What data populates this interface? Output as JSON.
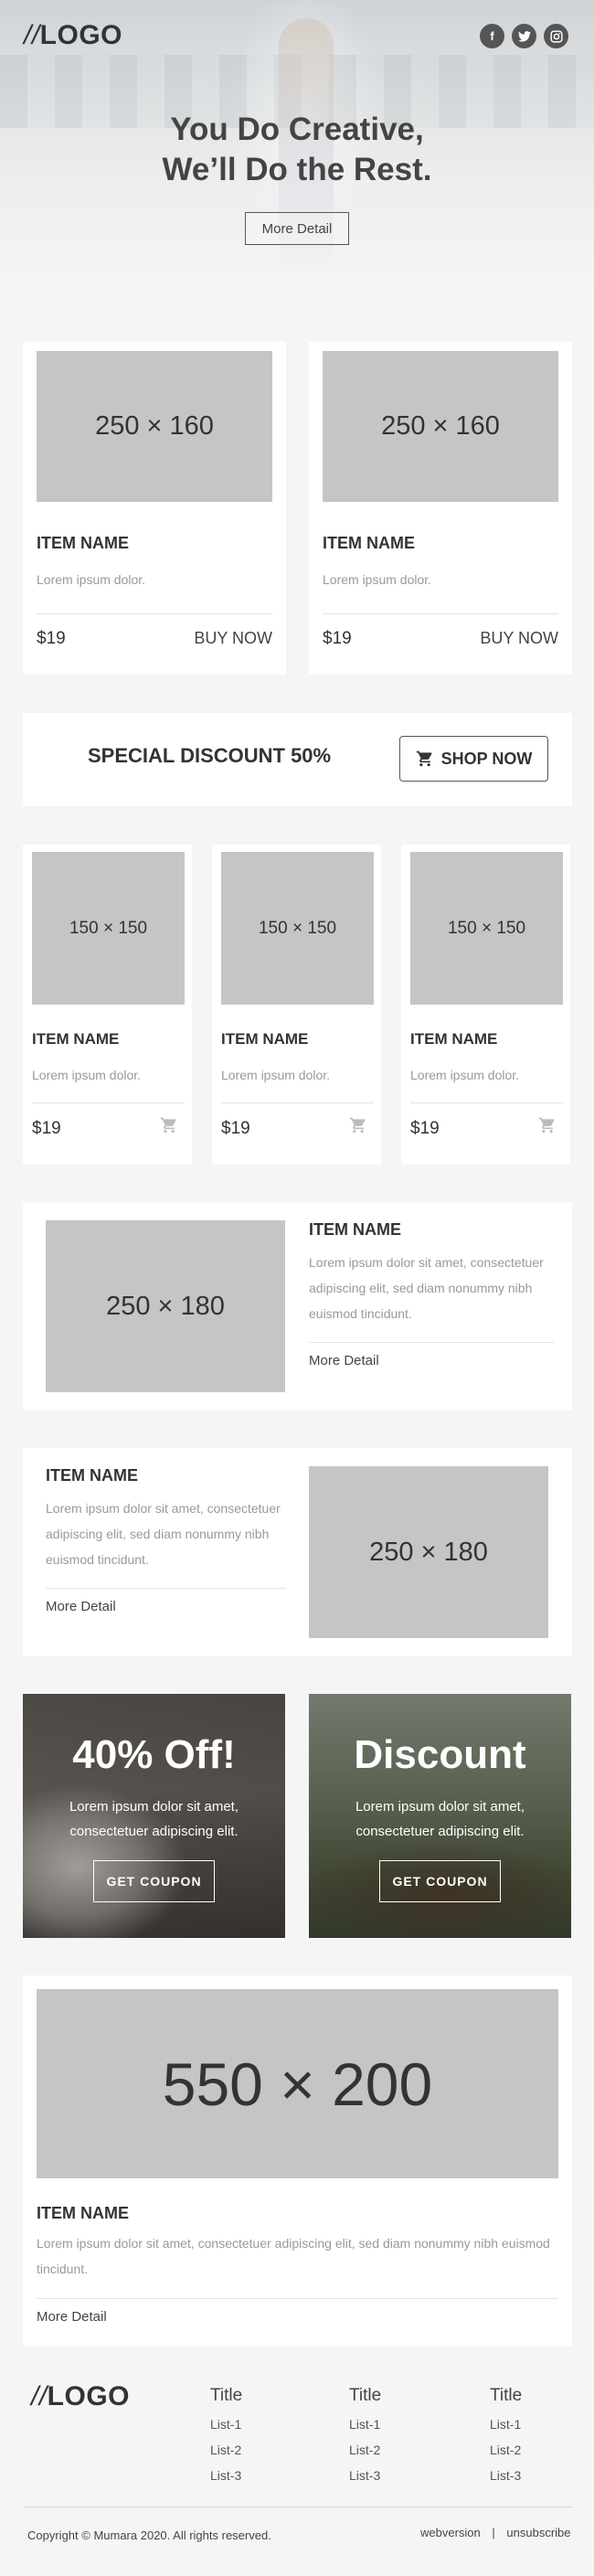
{
  "header": {
    "logo_slashes": "//",
    "logo_text": "LOGO",
    "social": [
      {
        "icon": "facebook-icon",
        "glyph": "f"
      },
      {
        "icon": "twitter-icon",
        "glyph": "t"
      },
      {
        "icon": "instagram-icon",
        "glyph": "◎"
      }
    ],
    "title_line1": "You Do Creative,",
    "title_line2": "We’ll Do the Rest.",
    "button": "More Detail"
  },
  "products_2col": [
    {
      "image": "250 × 160",
      "name": "ITEM NAME",
      "desc": "Lorem ipsum dolor.",
      "price": "$19",
      "buy": "BUY NOW"
    },
    {
      "image": "250 × 160",
      "name": "ITEM NAME",
      "desc": "Lorem ipsum dolor.",
      "price": "$19",
      "buy": "BUY NOW"
    }
  ],
  "discount_bar": {
    "text": "SPECIAL DISCOUNT 50%",
    "button": "SHOP NOW",
    "icon": "cart-icon"
  },
  "products_3col": [
    {
      "image": "150 × 150",
      "name": "ITEM NAME",
      "desc": "Lorem ipsum dolor.",
      "price": "$19",
      "icon": "cart-icon"
    },
    {
      "image": "150 × 150",
      "name": "ITEM NAME",
      "desc": "Lorem ipsum dolor.",
      "price": "$19",
      "icon": "cart-icon"
    },
    {
      "image": "150 × 150",
      "name": "ITEM NAME",
      "desc": "Lorem ipsum dolor.",
      "price": "$19",
      "icon": "cart-icon"
    }
  ],
  "feature_1": {
    "image": "250 × 180",
    "name": "ITEM NAME",
    "desc": "Lorem ipsum dolor sit amet, consectetuer adipiscing elit, sed diam nonummy nibh euismod tincidunt.",
    "link": "More Detail"
  },
  "feature_2": {
    "image": "250 × 180",
    "name": "ITEM NAME",
    "desc": "Lorem ipsum dolor sit amet, consectetuer adipiscing elit, sed diam nonummy nibh euismod tincidunt.",
    "link": "More Detail"
  },
  "promos": [
    {
      "headline": "40% Off!",
      "desc": "Lorem ipsum dolor sit amet, consectetuer adipiscing elit.",
      "button": "GET COUPON"
    },
    {
      "headline": "Discount",
      "desc": "Lorem ipsum dolor sit amet, consectetuer adipiscing elit.",
      "button": "GET COUPON"
    }
  ],
  "feature_wide": {
    "image": "550 × 200",
    "name": "ITEM NAME",
    "desc": "Lorem ipsum dolor sit amet, consectetuer adipiscing elit, sed diam nonummy nibh euismod tincidunt.",
    "link": "More Detail"
  },
  "footer": {
    "logo_slashes": "//",
    "logo_text": "LOGO",
    "columns": [
      {
        "title": "Title",
        "items": [
          "List-1",
          "List-2",
          "List-3"
        ]
      },
      {
        "title": "Title",
        "items": [
          "List-1",
          "List-2",
          "List-3"
        ]
      },
      {
        "title": "Title",
        "items": [
          "List-1",
          "List-2",
          "List-3"
        ]
      }
    ],
    "copyright": "Copyright © Mumara 2020. All rights reserved.",
    "webversion": "webversion",
    "separator": "|",
    "unsubscribe": "unsubscribe"
  },
  "colors": {
    "placeholder": "#c5c5c5",
    "card": "#ffffff",
    "background": "#f5f5f5",
    "text": "#333333"
  }
}
